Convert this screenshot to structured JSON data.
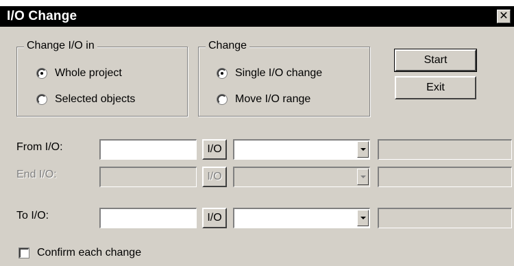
{
  "window": {
    "title": "I/O Change",
    "close_symbol": "✕"
  },
  "change_in_group": {
    "label": "Change I/O in",
    "options": [
      {
        "label": "Whole project",
        "checked": true
      },
      {
        "label": "Selected objects",
        "checked": false
      }
    ]
  },
  "change_group": {
    "label": "Change",
    "options": [
      {
        "label": "Single I/O change",
        "checked": true
      },
      {
        "label": "Move I/O range",
        "checked": false
      }
    ]
  },
  "buttons": {
    "start": "Start",
    "exit": "Exit"
  },
  "fields": {
    "from": {
      "label": "From I/O:",
      "io_button": "I/O",
      "enabled": true,
      "value": "",
      "combo_value": "",
      "result": ""
    },
    "end": {
      "label": "End I/O:",
      "io_button": "I/O",
      "enabled": false,
      "value": "",
      "combo_value": "",
      "result": ""
    },
    "to": {
      "label": "To I/O:",
      "io_button": "I/O",
      "enabled": true,
      "value": "",
      "combo_value": "",
      "result": ""
    }
  },
  "confirm": {
    "label": "Confirm each change",
    "checked": false
  }
}
